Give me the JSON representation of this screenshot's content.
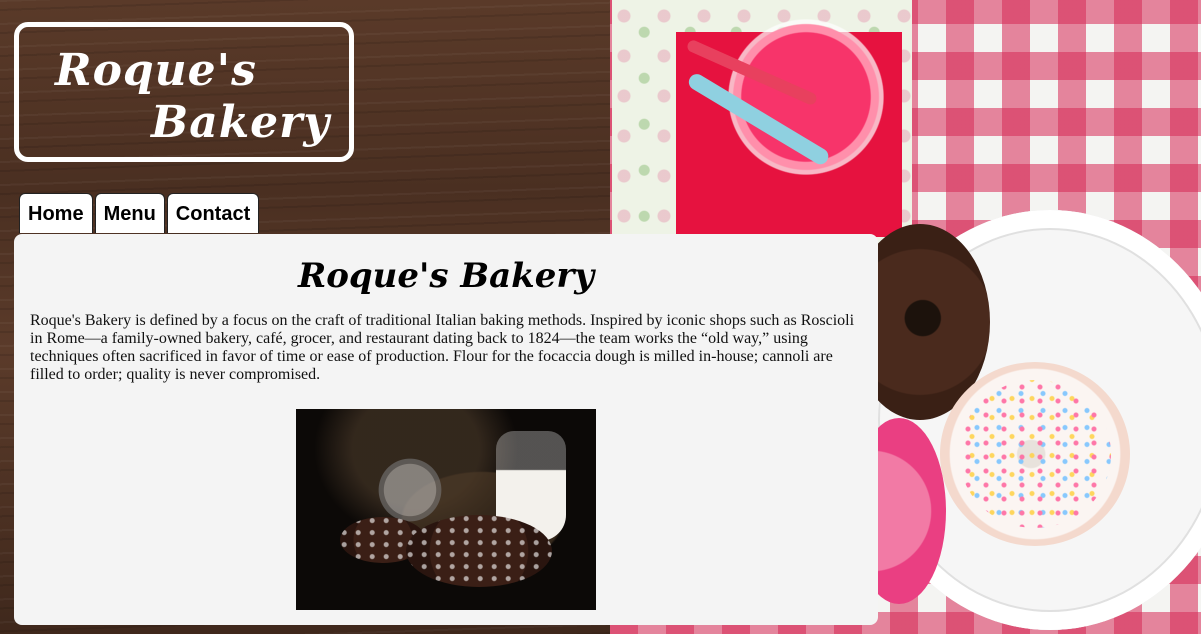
{
  "logo": {
    "line1": "Roque's",
    "line2": "Bakery"
  },
  "nav": {
    "tabs": [
      {
        "label": "Home"
      },
      {
        "label": "Menu"
      },
      {
        "label": "Contact"
      }
    ]
  },
  "main": {
    "heading": "Roque's Bakery",
    "paragraph": "Roque's Bakery is defined by a focus on the craft of traditional Italian baking methods. Inspired by iconic shops such as Roscioli in Rome—a family-owned bakery, café, grocer, and restaurant dating back to 1824—the team works the “old way,” using techniques often sacrificed in favor of time or ease of production. Flour for the focaccia dough is milled in-house; cannoli are filled to order; quality is never compromised."
  },
  "colors": {
    "panel_bg": "#f4f4f4",
    "logo_border": "#ffffff",
    "napkin": "#e6123f"
  }
}
